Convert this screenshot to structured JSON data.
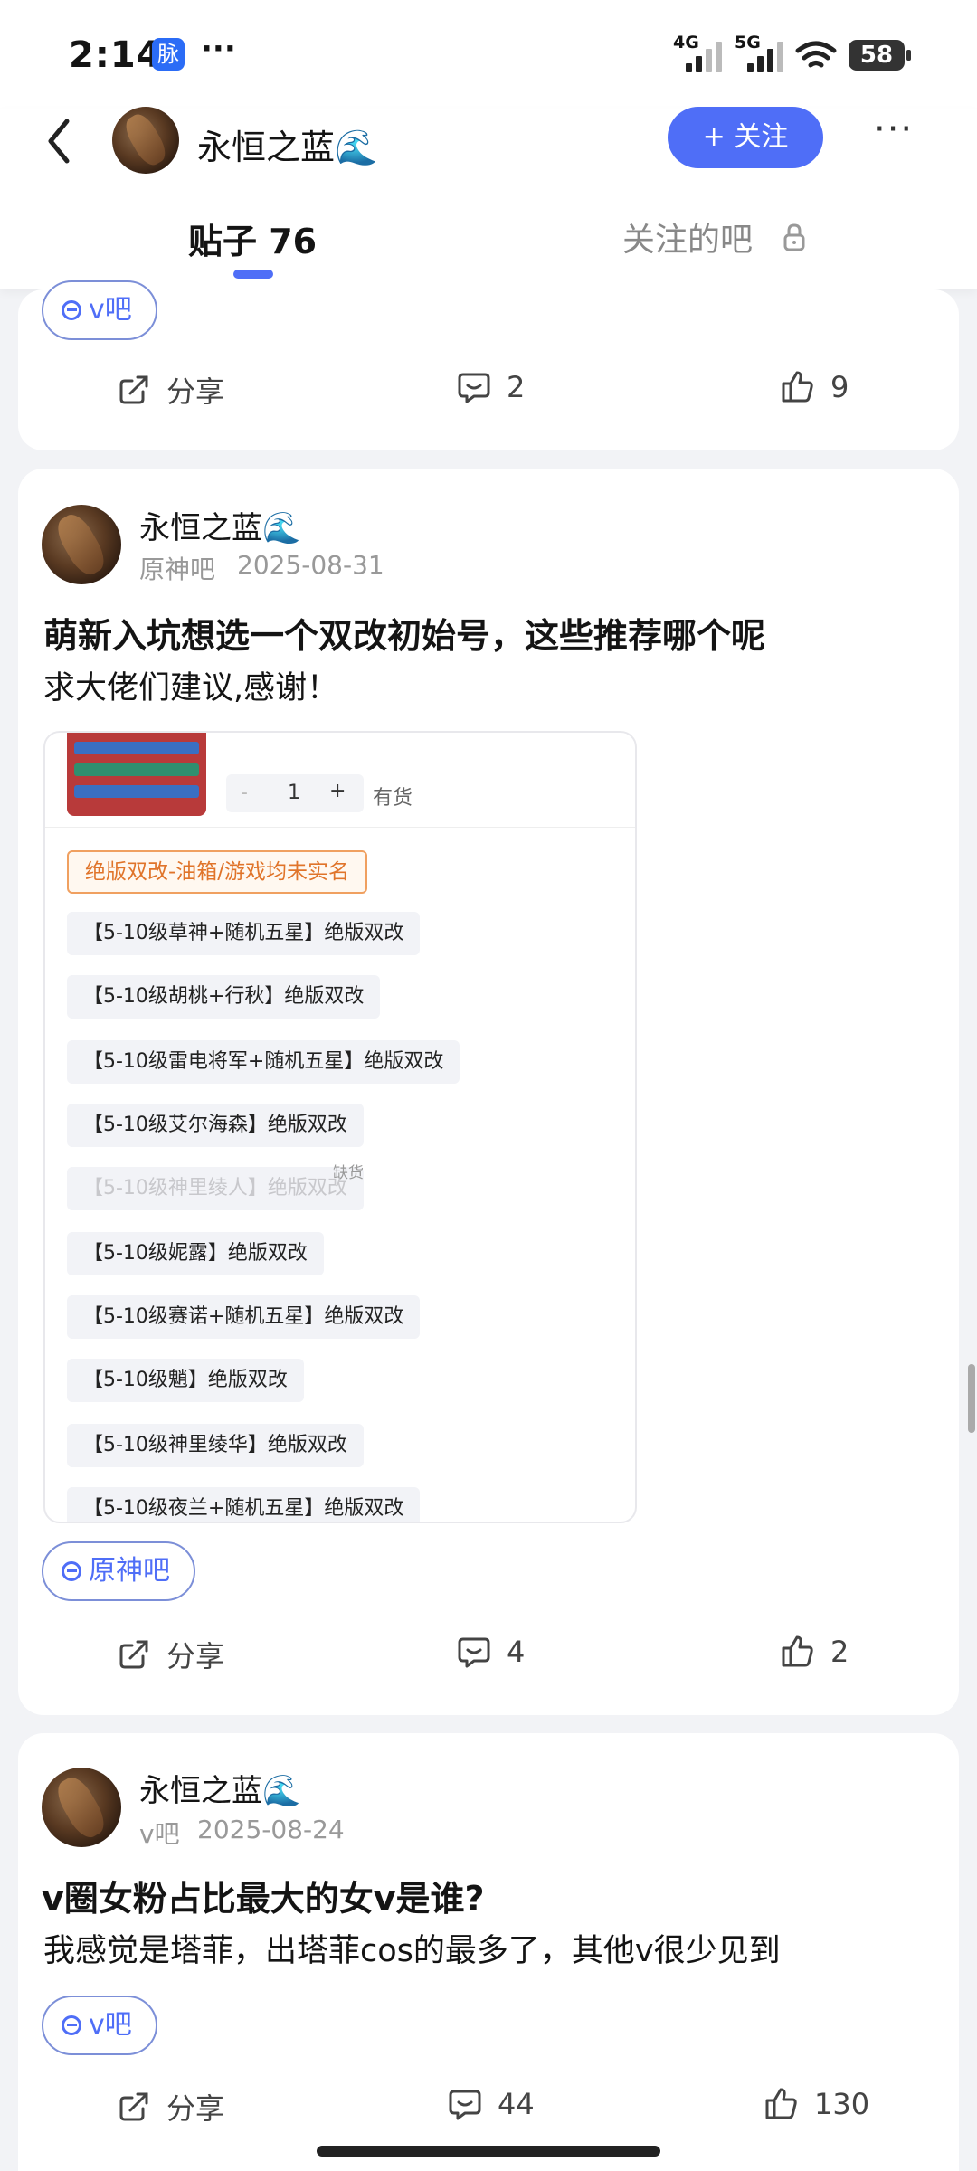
{
  "status_bar": {
    "time": "2:14",
    "badge": "脉",
    "more": "···",
    "net1": "4G",
    "net2": "5G",
    "battery": "58"
  },
  "header": {
    "user_name": "永恒之蓝🌊",
    "follow_label": "+ 关注",
    "more_label": "···"
  },
  "tabs": [
    {
      "label": "贴子 76",
      "active": true
    },
    {
      "label": "关注的吧",
      "active": false
    }
  ],
  "posts": [
    {
      "tag": "v吧",
      "actions": {
        "share": "分享",
        "comments": "2",
        "likes": "9"
      }
    },
    {
      "user": "永恒之蓝🌊",
      "forum": "原神吧",
      "date": "2025-08-31",
      "title": "萌新入坑想选一个双改初始号，这些推荐哪个呢",
      "body": "求大佬们建议,感谢！",
      "shop": {
        "qty": "1",
        "minus": "-",
        "plus": "+",
        "stock": "有货",
        "selected_option": "绝版双改-油箱/游戏均未实名",
        "options": [
          "【5-10级草神+随机五星】绝版双改",
          "【5-10级胡桃+行秋】绝版双改",
          "【5-10级雷电将军+随机五星】绝版双改",
          "【5-10级艾尔海森】绝版双改",
          "【5-10级神里绫人】绝版双改",
          "【5-10级妮露】绝版双改",
          "【5-10级赛诺+随机五星】绝版双改",
          "【5-10级魈】绝版双改",
          "【5-10级神里绫华】绝版双改",
          "【5-10级夜兰+随机五星】绝版双改"
        ],
        "out_of_stock_label": "缺货"
      },
      "tag": "原神吧",
      "actions": {
        "share": "分享",
        "comments": "4",
        "likes": "2"
      }
    },
    {
      "user": "永恒之蓝🌊",
      "forum": "v吧",
      "date": "2025-08-24",
      "title": "v圈女粉占比最大的女v是谁?",
      "body": "我感觉是塔菲，出塔菲cos的最多了，其他v很少见到",
      "tag": "v吧",
      "actions": {
        "share": "分享",
        "comments": "44",
        "likes": "130"
      }
    }
  ],
  "colors": {
    "accent": "#4f6ef7",
    "background": "#f2f3f6",
    "orange_tag": "#e0742a"
  }
}
